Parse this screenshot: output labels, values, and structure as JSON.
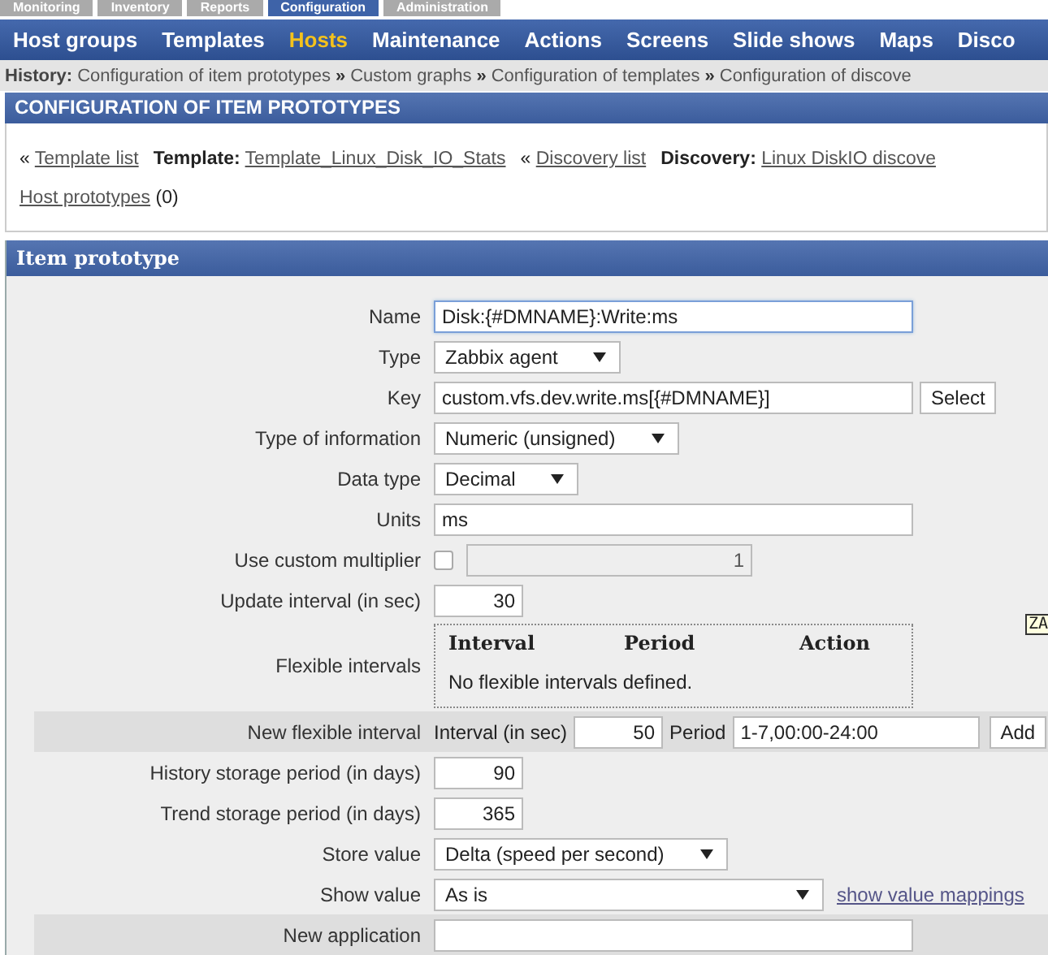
{
  "top_tabs": [
    {
      "label": "Monitoring",
      "selected": false
    },
    {
      "label": "Inventory",
      "selected": false
    },
    {
      "label": "Reports",
      "selected": false
    },
    {
      "label": "Configuration",
      "selected": true
    },
    {
      "label": "Administration",
      "selected": false
    }
  ],
  "nav": [
    {
      "label": "Host groups",
      "selected": false
    },
    {
      "label": "Templates",
      "selected": false
    },
    {
      "label": "Hosts",
      "selected": true
    },
    {
      "label": "Maintenance",
      "selected": false
    },
    {
      "label": "Actions",
      "selected": false
    },
    {
      "label": "Screens",
      "selected": false
    },
    {
      "label": "Slide shows",
      "selected": false
    },
    {
      "label": "Maps",
      "selected": false
    },
    {
      "label": "Disco",
      "selected": false
    }
  ],
  "history": {
    "label": "History:",
    "items": [
      "Configuration of item prototypes",
      "Custom graphs",
      "Configuration of templates",
      "Configuration of discove"
    ],
    "separator": "»"
  },
  "page_title": "CONFIGURATION OF ITEM PROTOTYPES",
  "context": {
    "back_mark": "«",
    "template_list": "Template list",
    "template_label": "Template:",
    "template": "Template_Linux_Disk_IO_Stats",
    "discovery_list": "Discovery list",
    "discovery_label": "Discovery:",
    "discovery": "Linux DiskIO discove",
    "host_prototypes": "Host prototypes",
    "host_prototypes_count": "(0)"
  },
  "form": {
    "title": "Item prototype",
    "rows": [
      {
        "kind": "text",
        "label": "Name",
        "value": "Disk:{#DMNAME}:Write:ms",
        "focused": true
      },
      {
        "kind": "select",
        "label": "Type",
        "value": "Zabbix agent"
      },
      {
        "kind": "text-button",
        "label": "Key",
        "value": "custom.vfs.dev.write.ms[{#DMNAME}]",
        "button": "Select"
      },
      {
        "kind": "select",
        "label": "Type of information",
        "value": "Numeric (unsigned)"
      },
      {
        "kind": "select",
        "label": "Data type",
        "value": "Decimal"
      },
      {
        "kind": "text",
        "label": "Units",
        "value": "ms",
        "focused": false
      },
      {
        "kind": "checkbox-number",
        "label": "Use custom multiplier",
        "checked": false,
        "value": "1"
      },
      {
        "kind": "number",
        "label": "Update interval (in sec)",
        "value": "30"
      },
      {
        "kind": "flex-table",
        "label": "Flexible intervals",
        "columns": [
          "Interval",
          "Period",
          "Action"
        ],
        "empty_text": "No flexible intervals defined."
      },
      {
        "kind": "new-flex",
        "label": "New flexible interval",
        "interval_label": "Interval (in sec)",
        "interval": "50",
        "period_label": "Period",
        "period": "1-7,00:00-24:00",
        "button": "Add"
      },
      {
        "kind": "number",
        "label": "History storage period (in days)",
        "value": "90"
      },
      {
        "kind": "number",
        "label": "Trend storage period (in days)",
        "value": "365"
      },
      {
        "kind": "select",
        "label": "Store value",
        "value": "Delta (speed per second)"
      },
      {
        "kind": "select-link",
        "label": "Show value",
        "value": "As is",
        "link": "show value mappings"
      },
      {
        "kind": "text-band",
        "label": "New application",
        "value": ""
      }
    ]
  },
  "tooltip": "ZA"
}
